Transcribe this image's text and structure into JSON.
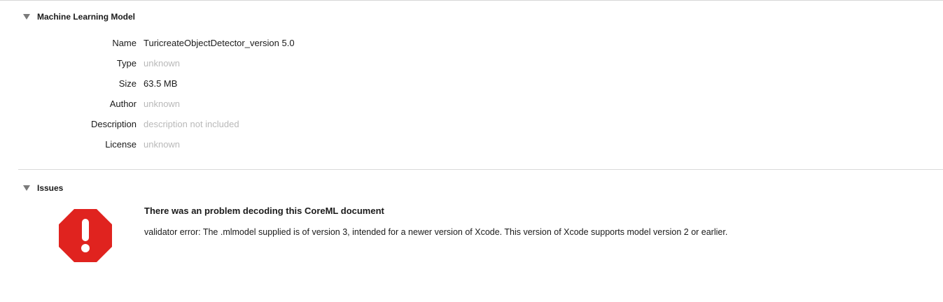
{
  "model_section": {
    "title": "Machine Learning Model",
    "properties": [
      {
        "label": "Name",
        "value": "TuricreateObjectDetector_version 5.0",
        "dim": false
      },
      {
        "label": "Type",
        "value": "unknown",
        "dim": true
      },
      {
        "label": "Size",
        "value": "63.5 MB",
        "dim": false
      },
      {
        "label": "Author",
        "value": "unknown",
        "dim": true
      },
      {
        "label": "Description",
        "value": "description not included",
        "dim": true
      },
      {
        "label": "License",
        "value": "unknown",
        "dim": true
      }
    ]
  },
  "issues_section": {
    "title": "Issues",
    "issue": {
      "icon": "error-stop-icon",
      "title": "There was an problem decoding this CoreML document",
      "message": "validator error: The .mlmodel supplied is of version 3, intended for a newer version of Xcode. This version of Xcode supports model version 2 or earlier."
    }
  },
  "colors": {
    "error_red": "#e0231f",
    "dim_text": "#b9b9b9",
    "disclosure": "#7b7b7b"
  }
}
